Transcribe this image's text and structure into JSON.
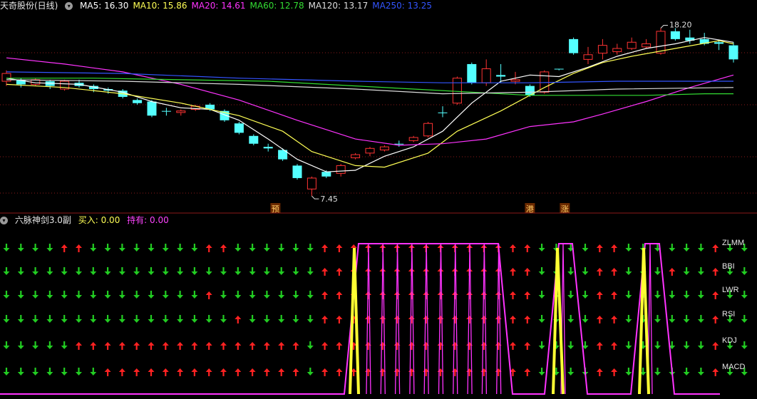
{
  "header": {
    "title": "天奇股份(日线)",
    "ma": [
      {
        "label": "MA5: 16.30",
        "color": "#ffffff"
      },
      {
        "label": "MA10: 15.86",
        "color": "#ffff55"
      },
      {
        "label": "MA20: 14.61",
        "color": "#ff33ff"
      },
      {
        "label": "MA60: 12.78",
        "color": "#33dd33"
      },
      {
        "label": "MA120: 13.17",
        "color": "#dddddd"
      },
      {
        "label": "MA250: 13.25",
        "color": "#3355ff"
      }
    ]
  },
  "markers": {
    "high": "18.20",
    "low": "7.45",
    "yu": "预",
    "gang": "港",
    "zhang": "涨"
  },
  "sub": {
    "title": "六脉神剑3.0副",
    "buy": "买入: 0.00",
    "hold": "持有: 0.00"
  },
  "indicators": [
    "ZLMM",
    "BBI",
    "LWR",
    "RSI",
    "KDJ",
    "MACD"
  ],
  "colors": {
    "up": "#ff3333",
    "down": "#54ffff",
    "arrow_up": "#ff2222",
    "arrow_down": "#22cc22",
    "hold": "#ff33ff",
    "buy": "#ffff33"
  },
  "chart_data": [
    {
      "type": "candlestick",
      "ylim": [
        7,
        19
      ],
      "candles": [
        [
          14.8,
          15.3,
          14.5,
          15.5
        ],
        [
          14.9,
          14.6,
          14.4,
          15.0
        ],
        [
          14.6,
          14.9,
          14.5,
          15.0
        ],
        [
          14.8,
          14.5,
          14.3,
          14.9
        ],
        [
          14.3,
          14.8,
          14.2,
          14.9
        ],
        [
          14.7,
          14.5,
          14.4,
          14.9
        ],
        [
          14.5,
          14.3,
          14.1,
          14.6
        ],
        [
          14.3,
          14.2,
          14.0,
          14.4
        ],
        [
          14.2,
          13.8,
          13.7,
          14.3
        ],
        [
          13.6,
          13.4,
          13.3,
          13.7
        ],
        [
          13.5,
          12.6,
          12.5,
          13.6
        ],
        [
          12.9,
          12.9,
          12.6,
          13.1
        ],
        [
          12.8,
          12.9,
          12.6,
          13.0
        ],
        [
          13.0,
          13.2,
          12.9,
          13.3
        ],
        [
          13.3,
          13.0,
          12.9,
          13.4
        ],
        [
          12.9,
          12.3,
          12.2,
          13.0
        ],
        [
          12.1,
          11.5,
          11.4,
          12.2
        ],
        [
          11.3,
          10.8,
          10.7,
          11.4
        ],
        [
          10.6,
          10.5,
          10.3,
          10.8
        ],
        [
          10.4,
          9.8,
          9.7,
          10.5
        ],
        [
          9.4,
          8.6,
          8.5,
          9.5
        ],
        [
          7.9,
          8.6,
          7.45,
          8.7
        ],
        [
          9.0,
          8.7,
          8.6,
          9.1
        ],
        [
          8.9,
          9.4,
          8.7,
          9.5
        ],
        [
          9.9,
          10.1,
          9.8,
          10.2
        ],
        [
          10.2,
          10.5,
          10.0,
          10.6
        ],
        [
          10.4,
          10.6,
          10.3,
          10.7
        ],
        [
          10.8,
          10.8,
          10.6,
          11.0
        ],
        [
          11.0,
          11.2,
          10.9,
          11.3
        ],
        [
          11.3,
          12.1,
          11.2,
          12.2
        ],
        [
          12.8,
          12.8,
          12.5,
          13.2
        ],
        [
          13.4,
          15.0,
          13.3,
          15.1
        ],
        [
          15.9,
          14.7,
          14.6,
          16.0
        ],
        [
          14.7,
          15.6,
          14.5,
          16.2
        ],
        [
          15.2,
          15.1,
          14.7,
          15.9
        ],
        [
          14.8,
          14.9,
          14.6,
          15.4
        ],
        [
          14.5,
          13.9,
          13.8,
          14.6
        ],
        [
          14.1,
          15.4,
          14.0,
          15.5
        ],
        [
          15.6,
          15.6,
          15.5,
          15.6
        ],
        [
          17.5,
          16.6,
          16.5,
          17.6
        ],
        [
          16.2,
          16.5,
          15.9,
          17.0
        ],
        [
          16.6,
          17.1,
          16.2,
          17.5
        ],
        [
          16.7,
          16.9,
          16.5,
          17.2
        ],
        [
          16.9,
          17.3,
          16.8,
          17.6
        ],
        [
          17.0,
          17.2,
          16.9,
          17.5
        ],
        [
          16.6,
          18.0,
          16.5,
          18.2
        ],
        [
          18.0,
          17.5,
          17.4,
          18.2
        ],
        [
          17.6,
          17.4,
          17.2,
          18.1
        ],
        [
          17.5,
          17.2,
          17.1,
          17.9
        ],
        [
          17.3,
          17.2,
          16.8,
          17.4
        ],
        [
          17.1,
          16.2,
          16.0,
          17.3
        ]
      ],
      "series": [
        {
          "name": "MA5",
          "color": "#ffffff",
          "values": [
            [
              0,
              15.0
            ],
            [
              2,
              14.7
            ],
            [
              5,
              14.6
            ],
            [
              8,
              14.1
            ],
            [
              10,
              13.5
            ],
            [
              12,
              13.1
            ],
            [
              14,
              13.0
            ],
            [
              16,
              12.3
            ],
            [
              18,
              11.1
            ],
            [
              20,
              9.8
            ],
            [
              22,
              9.0
            ],
            [
              24,
              9.1
            ],
            [
              26,
              10.0
            ],
            [
              28,
              10.6
            ],
            [
              30,
              11.6
            ],
            [
              32,
              13.4
            ],
            [
              34,
              14.8
            ],
            [
              36,
              15.2
            ],
            [
              38,
              15.1
            ],
            [
              40,
              15.7
            ],
            [
              42,
              16.4
            ],
            [
              44,
              16.9
            ],
            [
              46,
              17.2
            ],
            [
              48,
              17.6
            ],
            [
              50,
              17.3
            ]
          ]
        },
        {
          "name": "MA10",
          "color": "#ffff55",
          "values": [
            [
              0,
              14.6
            ],
            [
              4,
              14.4
            ],
            [
              8,
              14.0
            ],
            [
              12,
              13.4
            ],
            [
              16,
              12.6
            ],
            [
              19,
              11.6
            ],
            [
              21,
              10.3
            ],
            [
              24,
              9.4
            ],
            [
              26,
              9.3
            ],
            [
              29,
              10.2
            ],
            [
              31,
              11.6
            ],
            [
              34,
              12.9
            ],
            [
              37,
              14.4
            ],
            [
              39,
              15.3
            ],
            [
              41,
              16.0
            ],
            [
              43,
              16.4
            ],
            [
              46,
              16.9
            ],
            [
              49,
              17.4
            ],
            [
              50,
              17.2
            ]
          ]
        },
        {
          "name": "MA20",
          "color": "#ff33ff",
          "values": [
            [
              0,
              16.3
            ],
            [
              4,
              15.9
            ],
            [
              8,
              15.4
            ],
            [
              12,
              14.6
            ],
            [
              16,
              13.6
            ],
            [
              20,
              12.3
            ],
            [
              24,
              11.1
            ],
            [
              27,
              10.7
            ],
            [
              30,
              10.8
            ],
            [
              33,
              11.1
            ],
            [
              36,
              11.9
            ],
            [
              39,
              12.2
            ],
            [
              41,
              12.7
            ],
            [
              44,
              13.5
            ],
            [
              47,
              14.4
            ],
            [
              50,
              15.2
            ]
          ]
        },
        {
          "name": "MA60",
          "color": "#33dd33",
          "values": [
            [
              0,
              15.0
            ],
            [
              6,
              15.0
            ],
            [
              12,
              14.9
            ],
            [
              18,
              14.8
            ],
            [
              24,
              14.5
            ],
            [
              28,
              14.3
            ],
            [
              32,
              14.1
            ],
            [
              36,
              13.9
            ],
            [
              40,
              13.9
            ],
            [
              44,
              13.9
            ],
            [
              48,
              14.0
            ],
            [
              50,
              14.0
            ]
          ]
        },
        {
          "name": "MA120",
          "color": "#dddddd",
          "values": [
            [
              0,
              14.9
            ],
            [
              8,
              14.8
            ],
            [
              16,
              14.6
            ],
            [
              24,
              14.3
            ],
            [
              30,
              14.0
            ],
            [
              36,
              14.1
            ],
            [
              42,
              14.3
            ],
            [
              50,
              14.4
            ]
          ]
        },
        {
          "name": "MA250",
          "color": "#3355ff",
          "values": [
            [
              0,
              15.4
            ],
            [
              8,
              15.3
            ],
            [
              16,
              15.0
            ],
            [
              24,
              14.8
            ],
            [
              30,
              14.7
            ],
            [
              36,
              14.7
            ],
            [
              42,
              14.8
            ],
            [
              50,
              14.8
            ]
          ]
        }
      ]
    },
    {
      "type": "signals",
      "categories": [
        "ZLMM",
        "BBI",
        "LWR",
        "RSI",
        "KDJ",
        "MACD"
      ],
      "signals": [
        "DDDDUUDDDDDDDDUUDDDDDDUUUUUUUUUUUUUUUDDDDUUDDDDDDUDD",
        "DDDDDDDDDDDDDDDDDDDDDDUUUUUUUUUUUUUUUDDDDUUDDDUDDUDD",
        "DDDDDDDDDDDDDDUDDDDDDDUUUUUUUUUUUUUUUDDDDUUDDDDDDUDD",
        "DDDDDDDDDDDDDDDDUDDDDDUUUUUUUUUUUUUUUDDDDUUDDDDDDUDD",
        "DDDDDUUUUUUUUUUUUUUUUDUUUUUUUUUUUUUUUDDDDUUDDDDDDUDD",
        "DDDDDDDUUUUUUUUUUUUUUDUUUUUUUUUUUUUUUDDDDUUDDDDDDUDD"
      ],
      "hold": [
        0,
        0,
        0,
        0,
        0,
        0,
        0,
        0,
        0,
        0,
        0,
        0,
        0,
        0,
        0,
        0,
        0,
        0,
        0,
        0,
        0,
        0,
        0,
        0,
        6,
        6,
        6,
        6,
        6,
        6,
        6,
        6,
        6,
        6,
        6,
        6,
        6,
        6,
        6,
        6,
        6,
        0,
        0,
        0,
        0,
        0,
        6,
        6,
        0,
        0,
        0,
        0,
        0,
        0,
        0,
        6,
        6,
        0,
        0,
        0,
        0,
        0
      ],
      "buy_bars": [
        24,
        38,
        44
      ]
    }
  ]
}
